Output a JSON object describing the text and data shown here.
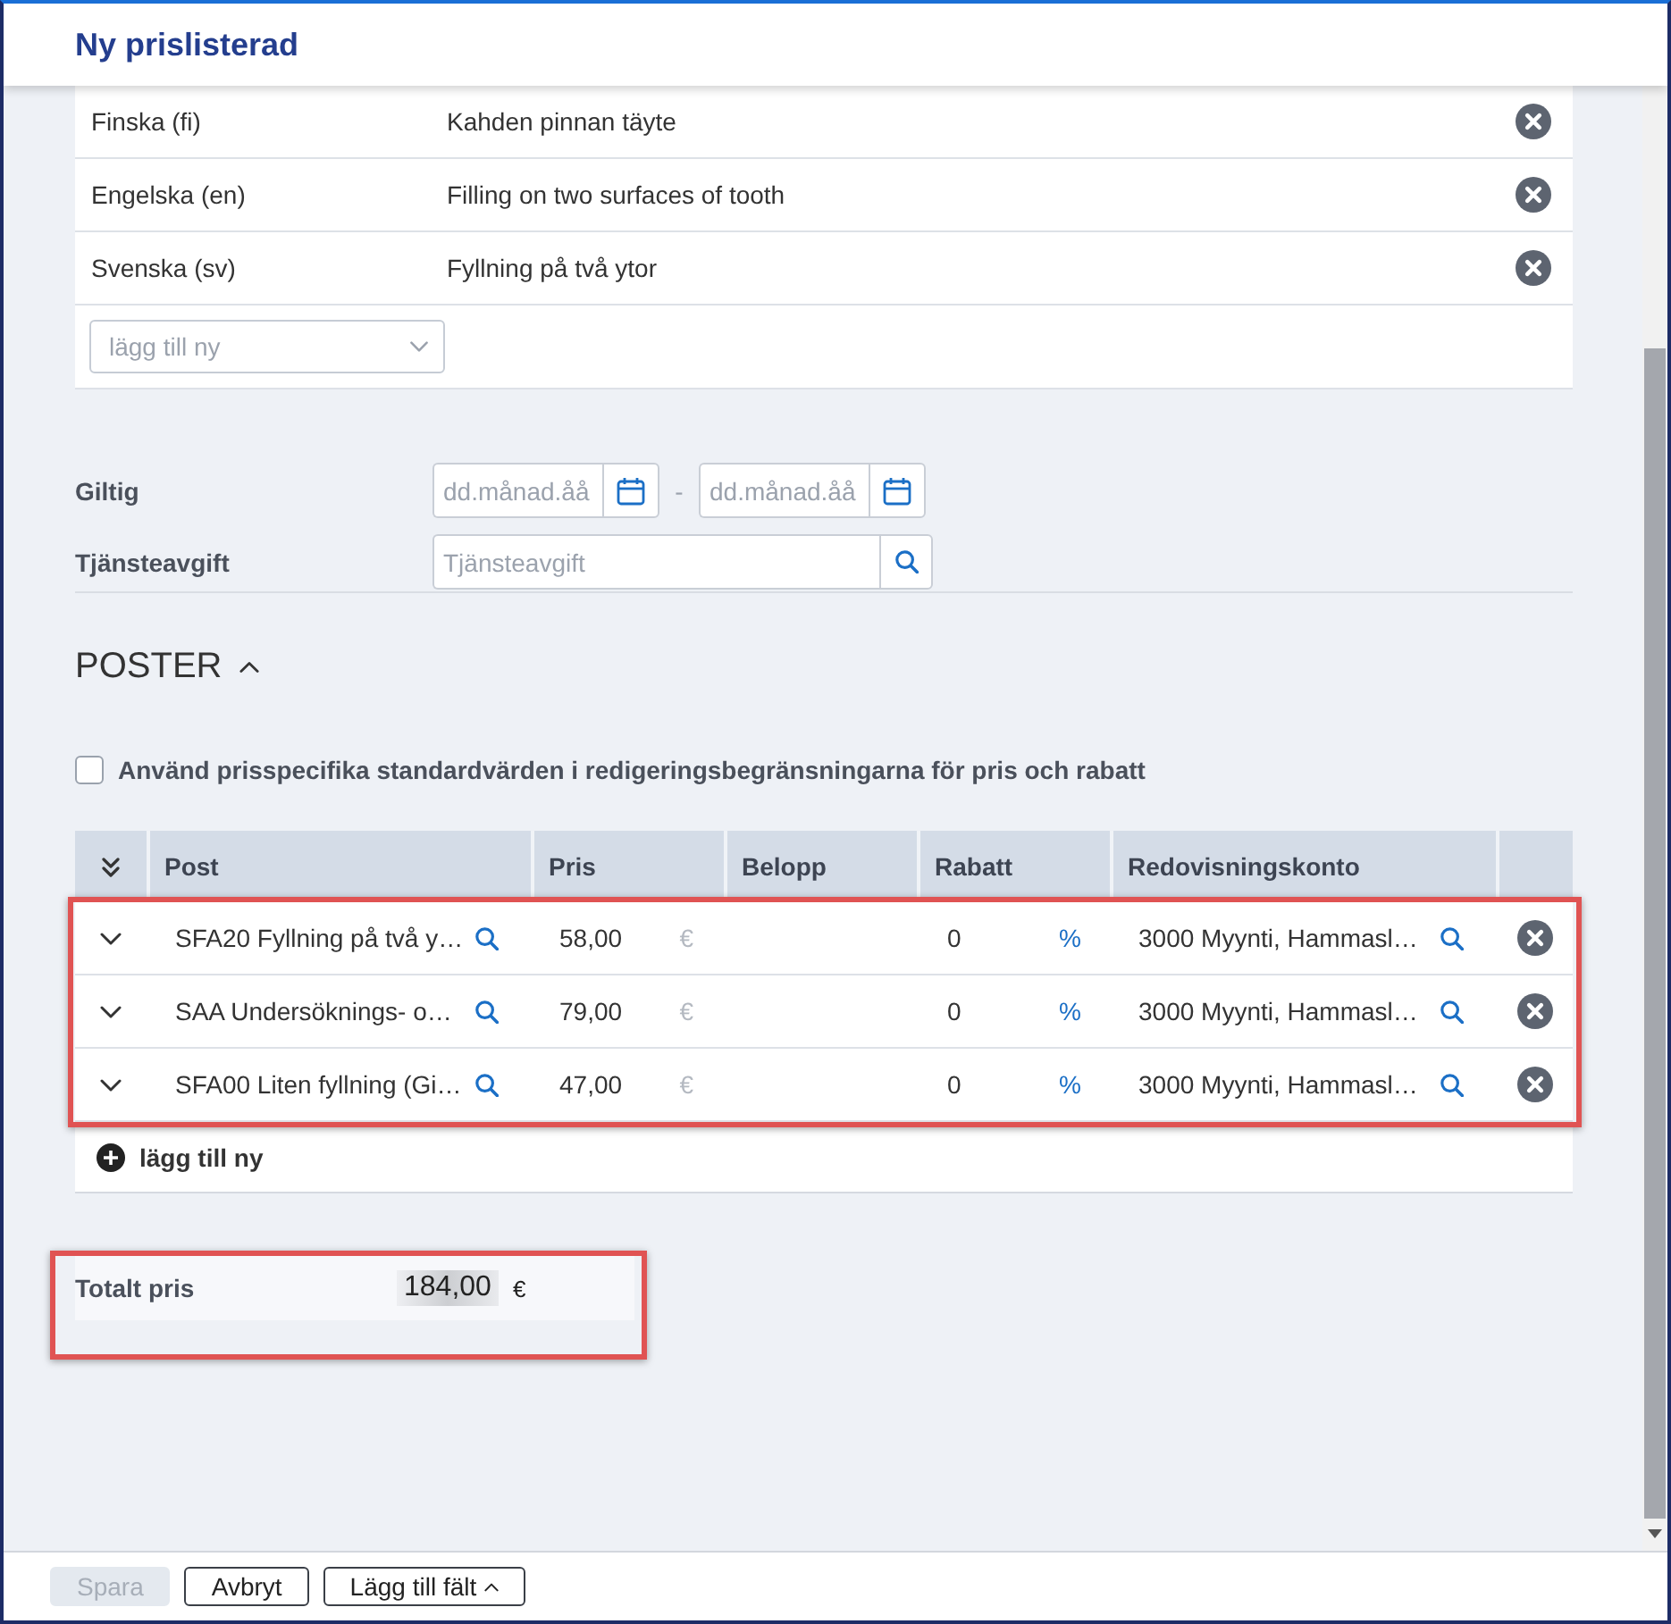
{
  "window": {
    "title": "Ny prislisterad"
  },
  "translations": {
    "rows": [
      {
        "language": "Finska (fi)",
        "text": "Kahden pinnan täyte"
      },
      {
        "language": "Engelska (en)",
        "text": "Filling on two surfaces of tooth"
      },
      {
        "language": "Svenska (sv)",
        "text": "Fyllning på två ytor"
      }
    ],
    "add_new": {
      "placeholder": "lägg till ny"
    }
  },
  "validity": {
    "label": "Giltig",
    "from": {
      "placeholder": "dd.månad.åå"
    },
    "separator": "-",
    "to": {
      "placeholder": "dd.månad.åå"
    }
  },
  "service_fee": {
    "label": "Tjänsteavgift",
    "placeholder": "Tjänsteavgift"
  },
  "poster": {
    "title": "POSTER",
    "expanded": true,
    "option": {
      "label": "Använd prisspecifika standardvärden i redigeringsbegränsningarna för pris och rabatt",
      "checked": false
    },
    "table": {
      "highlighted": true,
      "columns": [
        "Post",
        "Pris",
        "Belopp",
        "Rabatt",
        "Redovisningskonto"
      ],
      "rows": [
        {
          "expanded": false,
          "item": "SFA20 Fyllning på två y…",
          "price": "58,00",
          "currency": "€",
          "discount": "0",
          "discount_unit": "%",
          "account": "3000 Myynti, Hammasl…"
        },
        {
          "expanded": false,
          "item": "SAA Undersöknings- o…",
          "price": "79,00",
          "currency": "€",
          "discount": "0",
          "discount_unit": "%",
          "account": "3000 Myynti, Hammasl…"
        },
        {
          "expanded": false,
          "item": "SFA00 Liten fyllning (Gi…",
          "price": "47,00",
          "currency": "€",
          "discount": "0",
          "discount_unit": "%",
          "account": "3000 Myynti, Hammasl…"
        }
      ],
      "add_label": "lägg till ny"
    }
  },
  "total": {
    "highlighted": true,
    "label": "Totalt pris",
    "value": "184,00",
    "currency": "€"
  },
  "footer": {
    "buttons": [
      {
        "label": "Spara",
        "kind": "plain",
        "disabled": true
      },
      {
        "label": "Avbryt",
        "kind": "plain",
        "disabled": false
      },
      {
        "label": "Lägg till fält",
        "kind": "menu",
        "disabled": false
      }
    ]
  }
}
